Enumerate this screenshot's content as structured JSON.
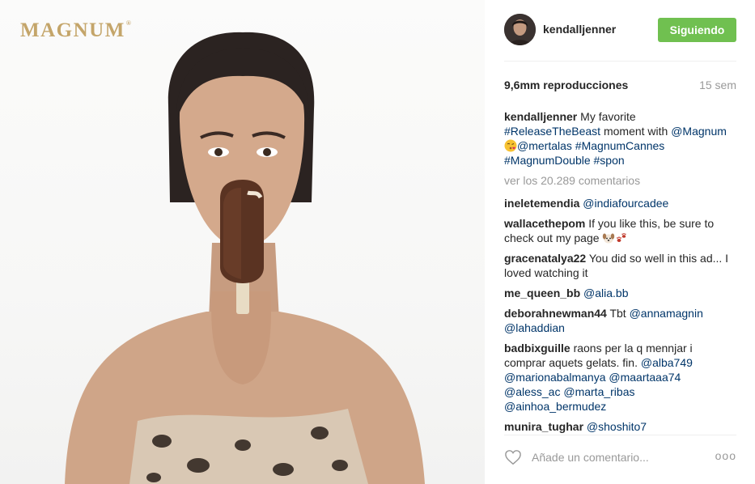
{
  "media": {
    "brand_logo": "MAGNUM",
    "brand_tm": "®"
  },
  "post": {
    "username": "kendalljenner",
    "follow_label": "Siguiendo",
    "views": "9,6mm reproducciones",
    "time_ago": "15 sem",
    "view_all_comments": "ver los 20.289 comentarios",
    "caption": {
      "author": "kendalljenner",
      "text_1": " My favorite ",
      "tag_1": "#ReleaseTheBeast",
      "text_2": " moment with ",
      "tag_2": "@Magnum",
      "tag_3": "@mertalas",
      "tag_4": "#MagnumCannes",
      "tag_5": "#MagnumDouble",
      "tag_6": "#spon"
    },
    "comments": [
      {
        "author": "ineletemendia",
        "text": "",
        "tags": "@indiafourcadee"
      },
      {
        "author": "wallacethepom",
        "text": " If you like this, be sure to check out my page ",
        "tags": ""
      },
      {
        "author": "gracenatalya22",
        "text": " You did so well in this ad... I loved watching it",
        "tags": ""
      },
      {
        "author": "me_queen_bb",
        "text": "",
        "tags": "@alia.bb"
      },
      {
        "author": "deborahnewman44",
        "text": " Tbt ",
        "tags": "@annamagnin @lahaddian"
      },
      {
        "author": "badbixguille",
        "text": " raons per la q mennjar i comprar aquets gelats. fin. ",
        "tags": "@alba749 @marionabalmanya @maartaaa74 @aless_ac @marta_ribas @ainhoa_bermudez"
      },
      {
        "author": "munira_tughar",
        "text": "",
        "tags": "@shoshito7"
      }
    ],
    "comment_placeholder": "Añade un comentario...",
    "more_label": "ooo"
  },
  "icons": {
    "heart": "heart-icon",
    "emoji_kiss": "kissing-face-icon",
    "emoji_dog": "dog-face-icon",
    "emoji_paws": "paw-prints-icon"
  },
  "colors": {
    "follow": "#70c050",
    "link": "#003569",
    "muted": "#999999",
    "brand_gold": "#c4a56a"
  }
}
